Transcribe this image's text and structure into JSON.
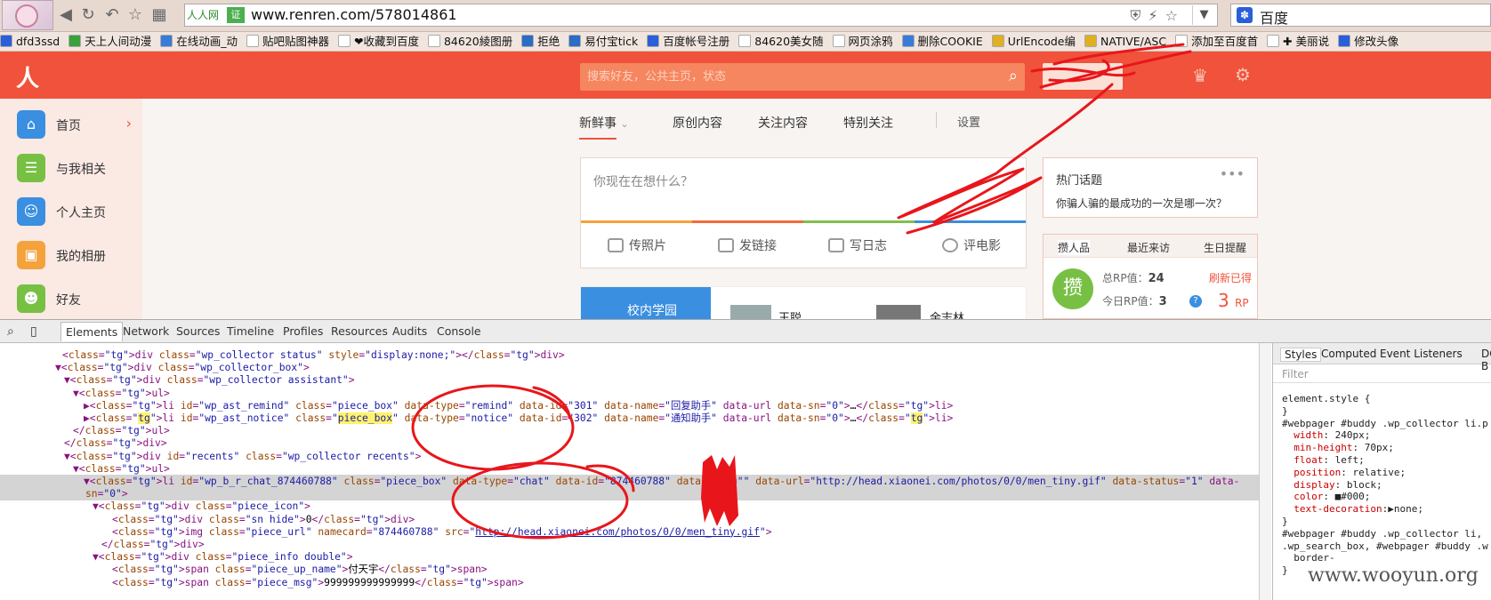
{
  "browser": {
    "site_tag": "人人网",
    "cert_badge": "证",
    "url": "www.renren.com/578014861",
    "search_engine_text": "百度",
    "paw_glyph": "✽"
  },
  "bookmarks": [
    {
      "label": "dfd3ssd",
      "icon": "baidu-paw-icon",
      "color": "#2b5fd9"
    },
    {
      "label": "天上人间动漫",
      "icon": "green-site-icon",
      "color": "#3aa03a"
    },
    {
      "label": "在线动画_动",
      "icon": "blue-site-icon",
      "color": "#3a7ad8"
    },
    {
      "label": "贴吧贴图神器",
      "icon": "page-icon",
      "color": "#ffffff"
    },
    {
      "label": "❤收藏到百度",
      "icon": "page-icon",
      "color": "#ffffff"
    },
    {
      "label": "84620綾图册",
      "icon": "page-icon",
      "color": "#ffffff"
    },
    {
      "label": "拒绝",
      "icon": "blue-site-icon",
      "color": "#2b6cc4"
    },
    {
      "label": "易付宝tick",
      "icon": "blue-site-icon",
      "color": "#2b6cc4"
    },
    {
      "label": "百度帐号注册",
      "icon": "baidu-paw-icon",
      "color": "#2b5fd9"
    },
    {
      "label": "84620美女随",
      "icon": "page-icon",
      "color": "#ffffff"
    },
    {
      "label": "网页涂鸦",
      "icon": "page-icon",
      "color": "#ffffff"
    },
    {
      "label": "删除COOKIE",
      "icon": "shield-icon",
      "color": "#3a7ad8"
    },
    {
      "label": "UrlEncode编",
      "icon": "yellow-site-icon",
      "color": "#e0b020"
    },
    {
      "label": "NATIVE/ASC",
      "icon": "yellow-site-icon",
      "color": "#e0b020"
    },
    {
      "label": "添加至百度首",
      "icon": "page-icon",
      "color": "#ffffff"
    },
    {
      "label": "✚ 美丽说",
      "icon": "page-icon",
      "color": "#ffffff"
    },
    {
      "label": "修改头像",
      "icon": "baidu-paw-icon",
      "color": "#2b5fd9"
    }
  ],
  "renren": {
    "logo": "人人",
    "search_placeholder": "搜索好友，公共主页，状态",
    "sidebar": [
      {
        "label": "首页",
        "icon": "home-icon",
        "color": "#3a8fe0",
        "glyph": "⌂"
      },
      {
        "label": "与我相关",
        "icon": "contact-card-icon",
        "color": "#77c043",
        "glyph": "☰"
      },
      {
        "label": "个人主页",
        "icon": "person-icon",
        "color": "#3a8fe0",
        "glyph": "☺"
      },
      {
        "label": "我的相册",
        "icon": "photo-album-icon",
        "color": "#f4a23b",
        "glyph": "▣"
      },
      {
        "label": "好友",
        "icon": "friends-icon",
        "color": "#77c043",
        "glyph": "☻"
      }
    ],
    "feed_tabs": [
      "新鲜事",
      "原创内容",
      "关注内容",
      "特别关注",
      "设置"
    ],
    "composer": {
      "placeholder": "你现在在想什么？",
      "actions": [
        "传照片",
        "发链接",
        "写日志",
        "评电影"
      ]
    },
    "feed_preview": {
      "banner": "校内学园",
      "name1": "王聪",
      "name2": "余志林"
    },
    "hot_topics": {
      "title": "热门话题",
      "question": "你骗人骗的最成功的一次是哪一次？"
    },
    "rp_panel": {
      "tabs": [
        "攒人品",
        "最近来访",
        "生日提醒"
      ],
      "badge": "攒",
      "total_label": "总RP值：",
      "total_value": "24",
      "today_label": "今日RP值：",
      "today_value": "3",
      "refresh_label": "刷新已得",
      "refresh_value": "3",
      "rp_unit": "RP"
    }
  },
  "devtools": {
    "tabs": [
      "Elements",
      "Network",
      "Sources",
      "Timeline",
      "Profiles",
      "Resources",
      "Audits",
      "Console"
    ],
    "styles_tabs": [
      "Styles",
      "Computed",
      "Event Listeners",
      "DOM B"
    ],
    "filter_placeholder": "Filter",
    "code_lines": [
      "<div class=\"wp_collector status\" style=\"display:none;\"></div>",
      "▼<div class=\"wp_collector_box\">",
      "▼<div class=\"wp_collector assistant\">",
      "▼<ul>",
      "▶<li id=\"wp_ast_remind\" class=\"piece_box\" data-type=\"remind\" data-id=\"301\" data-name=\"回复助手\" data-url data-sn=\"0\">…</li>",
      "▶<li id=\"wp_ast_notice\" class=\"piece_box\" data-type=\"notice\" data-id=\"302\" data-name=\"通知助手\" data-url data-sn=\"0\">…</li>",
      "</ul>",
      "</div>",
      "▼<div id=\"recents\" class=\"wp_collector recents\">",
      "▼<ul>",
      "▼<li id=\"wp_b_r_chat_874460788\" class=\"piece_box\" data-type=\"chat\" data-id=\"874460788\" data-name=\"\" data-url=\"http://head.xiaonei.com/photos/0/0/men_tiny.gif\" data-status=\"1\" data-",
      "sn=\"0\">",
      "▼<div class=\"piece_icon\">",
      "<div class=\"sn hide\">0</div>",
      "<img class=\"piece_url\" namecard=\"874460788\" src=\"http://head.xiaonei.com/photos/0/0/men_tiny.gif\">",
      "</div>",
      "▼<div class=\"piece_info double\">",
      "<span class=\"piece_up_name\">付天宇</span>",
      "<span class=\"piece_msg\">999999999999999</span>"
    ],
    "styles_lines": [
      "element.style {",
      "}",
      "#webpager #buddy .wp_collector li.p",
      "  width: 240px;",
      "  min-height: 70px;",
      "  float: left;",
      "  position: relative;",
      "  display: block;",
      "  color: ■#000;",
      "  text-decoration:▶none;",
      "}",
      "#webpager #buddy .wp_collector li,",
      ".wp_search_box, #webpager #buddy .w",
      "  border-",
      "}"
    ]
  },
  "watermark": "www.wooyun.org",
  "annotation_color": "#e8161b"
}
